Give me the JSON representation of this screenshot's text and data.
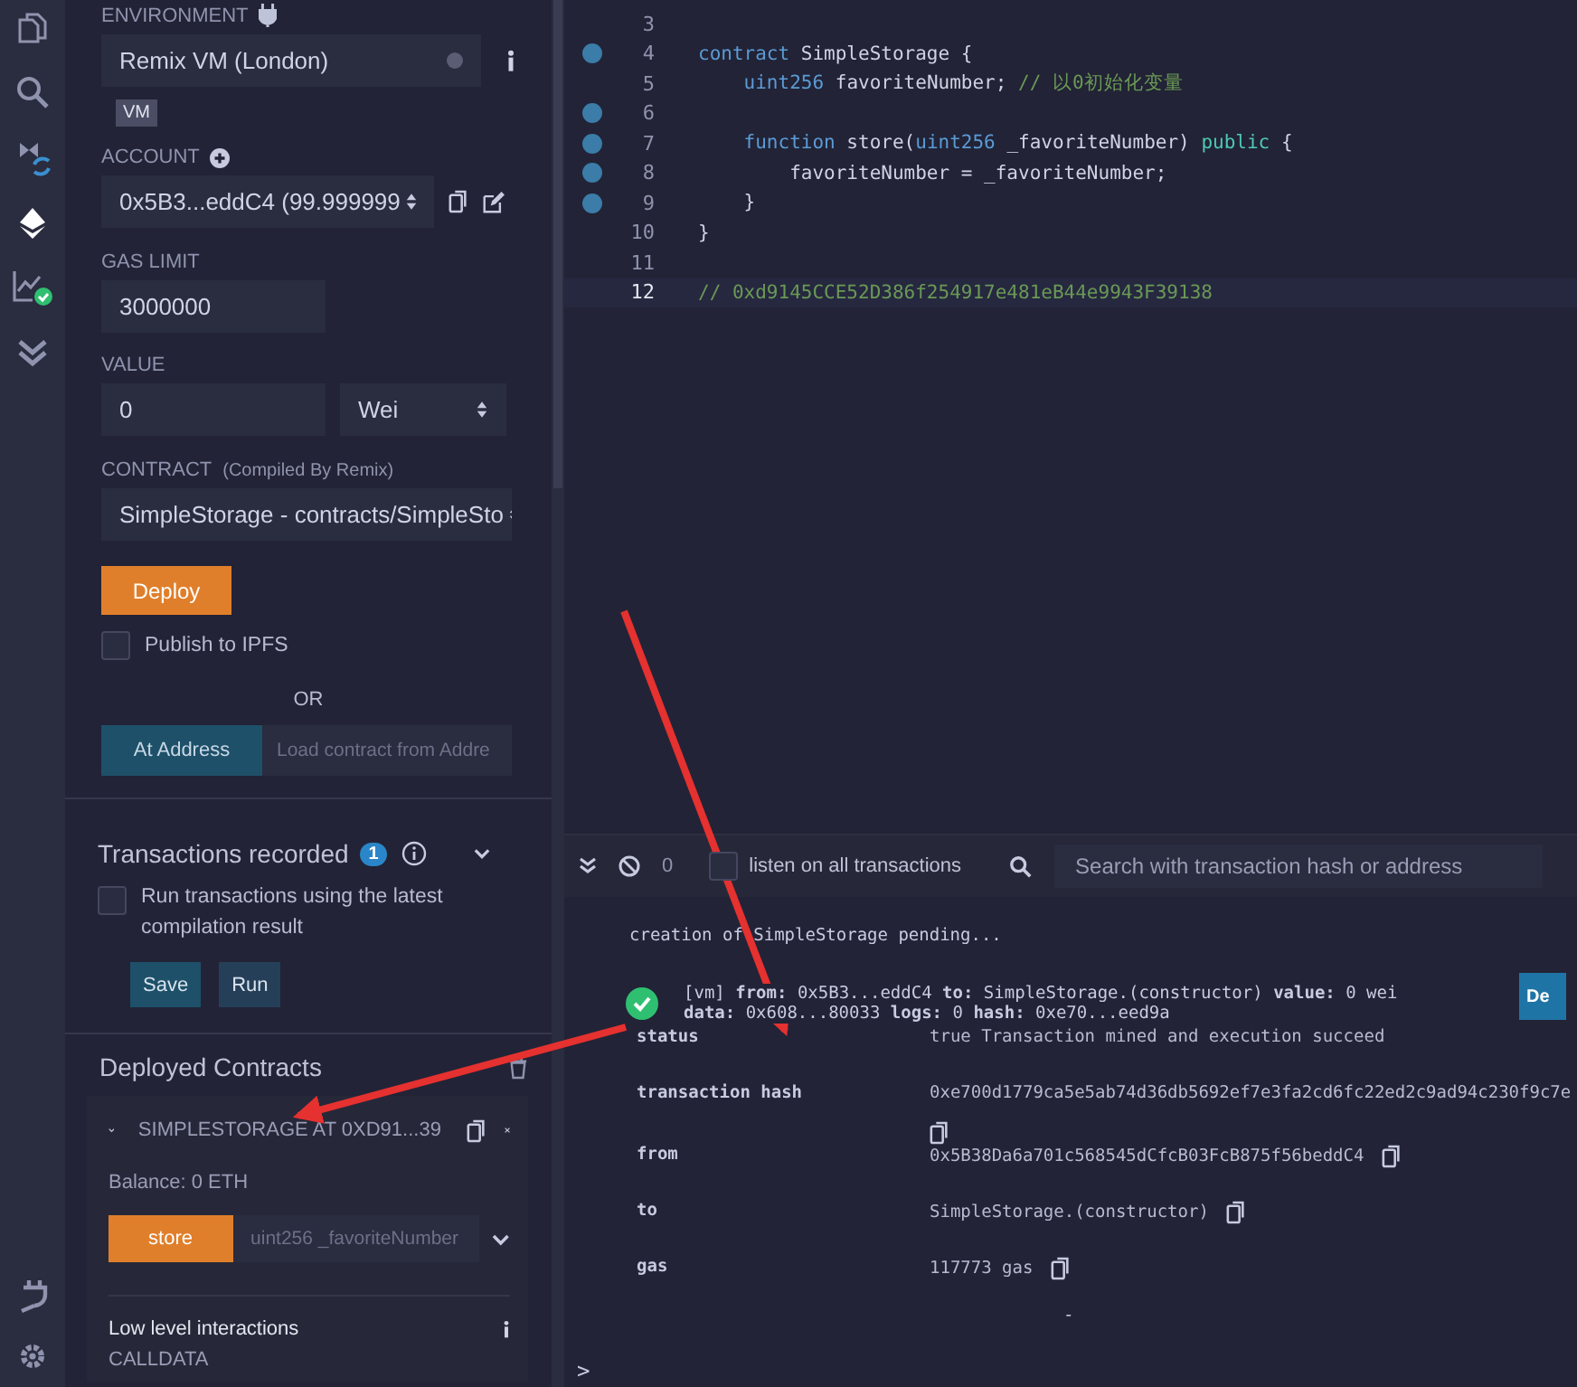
{
  "activity_bar": {
    "items": [
      {
        "kind": "files",
        "selected": false
      },
      {
        "kind": "search",
        "selected": false
      },
      {
        "kind": "compiler",
        "selected": false
      },
      {
        "kind": "deploy",
        "selected": true
      },
      {
        "kind": "analysis",
        "selected": false
      },
      {
        "kind": "tests",
        "selected": false
      }
    ],
    "bottom_items": [
      {
        "kind": "plugins",
        "selected": false
      },
      {
        "kind": "settings",
        "selected": false
      }
    ]
  },
  "run_panel": {
    "environment_label": "ENVIRONMENT",
    "environment_value": "Remix VM (London)",
    "vm_badge": "VM",
    "account_label": "ACCOUNT",
    "account_value": "0x5B3...eddC4 (99.999999",
    "gas_limit_label": "GAS LIMIT",
    "gas_limit_value": "3000000",
    "value_label": "VALUE",
    "value_value": "0",
    "value_unit": "Wei",
    "contract_label": "CONTRACT",
    "contract_hint": "(Compiled By Remix)",
    "contract_value": "SimpleStorage - contracts/SimpleSto",
    "deploy_button": "Deploy",
    "publish_label": "Publish to IPFS",
    "publish_checked": false,
    "or_label": "OR",
    "at_address_button": "At Address",
    "at_address_placeholder": "Load contract from Addre"
  },
  "transactions": {
    "title": "Transactions recorded",
    "count": "1",
    "run_latest_label": "Run transactions using the latest compilation result",
    "run_latest_checked": false,
    "save_button": "Save",
    "run_button": "Run"
  },
  "deployed": {
    "title": "Deployed Contracts",
    "instance_title": "SIMPLESTORAGE AT 0XD91...39",
    "expanded": true,
    "balance": "Balance: 0 ETH",
    "function_button": "store",
    "function_placeholder": "uint256 _favoriteNumber",
    "low_level_title": "Low level interactions",
    "calldata_label": "CALLDATA"
  },
  "editor": {
    "lines": [
      {
        "number": "3",
        "breakpoint": false,
        "active": false
      },
      {
        "number": "4",
        "breakpoint": true,
        "active": false,
        "tokens": [
          {
            "kind": "keyword",
            "text": "contract"
          },
          {
            "kind": "plain",
            "text": " SimpleStorage {"
          }
        ]
      },
      {
        "number": "5",
        "breakpoint": false,
        "active": false,
        "tokens": [
          {
            "kind": "keyword",
            "text": "    uint256"
          },
          {
            "kind": "plain",
            "text": " favoriteNumber; "
          },
          {
            "kind": "comment",
            "text": "// 以0初始化变量"
          }
        ]
      },
      {
        "number": "6",
        "breakpoint": true,
        "active": false
      },
      {
        "number": "7",
        "breakpoint": true,
        "active": false,
        "tokens": [
          {
            "kind": "keyword",
            "text": "    function"
          },
          {
            "kind": "plain",
            "text": " store("
          },
          {
            "kind": "keyword",
            "text": "uint256"
          },
          {
            "kind": "plain",
            "text": " _favoriteNumber) "
          },
          {
            "kind": "modifier",
            "text": "public"
          },
          {
            "kind": "plain",
            "text": " {"
          }
        ]
      },
      {
        "number": "8",
        "breakpoint": true,
        "active": false,
        "tokens": [
          {
            "kind": "plain",
            "text": "        favoriteNumber = _favoriteNumber;"
          }
        ]
      },
      {
        "number": "9",
        "breakpoint": true,
        "active": false,
        "tokens": [
          {
            "kind": "plain",
            "text": "    }"
          }
        ]
      },
      {
        "number": "10",
        "breakpoint": false,
        "active": false,
        "tokens": [
          {
            "kind": "plain",
            "text": "}"
          }
        ]
      },
      {
        "number": "11",
        "breakpoint": false,
        "active": false
      },
      {
        "number": "12",
        "breakpoint": false,
        "active": true,
        "tokens": [
          {
            "kind": "comment",
            "text": "// 0xd9145CCE52D386f254917e481eB44e9943F39138"
          }
        ]
      }
    ]
  },
  "terminal": {
    "count": "0",
    "listen_label": "listen on all transactions",
    "listen_checked": false,
    "search_placeholder": "Search with transaction hash or address",
    "pending_text": "creation of SimpleStorage pending...",
    "log_lines": [
      "[vm] **from:** 0x5B3...eddC4 **to:** SimpleStorage.(constructor) **value:** 0 wei",
      "**data:** 0x608...80033 **logs:** 0 **hash:** 0xe70...eed9a"
    ],
    "debug_button": "De",
    "details": [
      {
        "key": "status",
        "value": "true Transaction mined and execution succeed",
        "copy": false
      },
      {
        "key": "transaction hash",
        "value": "0xe700d1779ca5e5ab74d36db5692ef7e3fa2cd6fc22ed2c9ad94c230f9c7e",
        "copy": true
      },
      {
        "key": "from",
        "value": "0x5B38Da6a701c568545dCfcB03FcB875f56beddC4",
        "copy": true
      },
      {
        "key": "to",
        "value": "SimpleStorage.(constructor)",
        "copy": true
      },
      {
        "key": "gas",
        "value": "117773 gas",
        "copy": true
      }
    ],
    "collapse_mark": "-",
    "prompt": ">"
  }
}
